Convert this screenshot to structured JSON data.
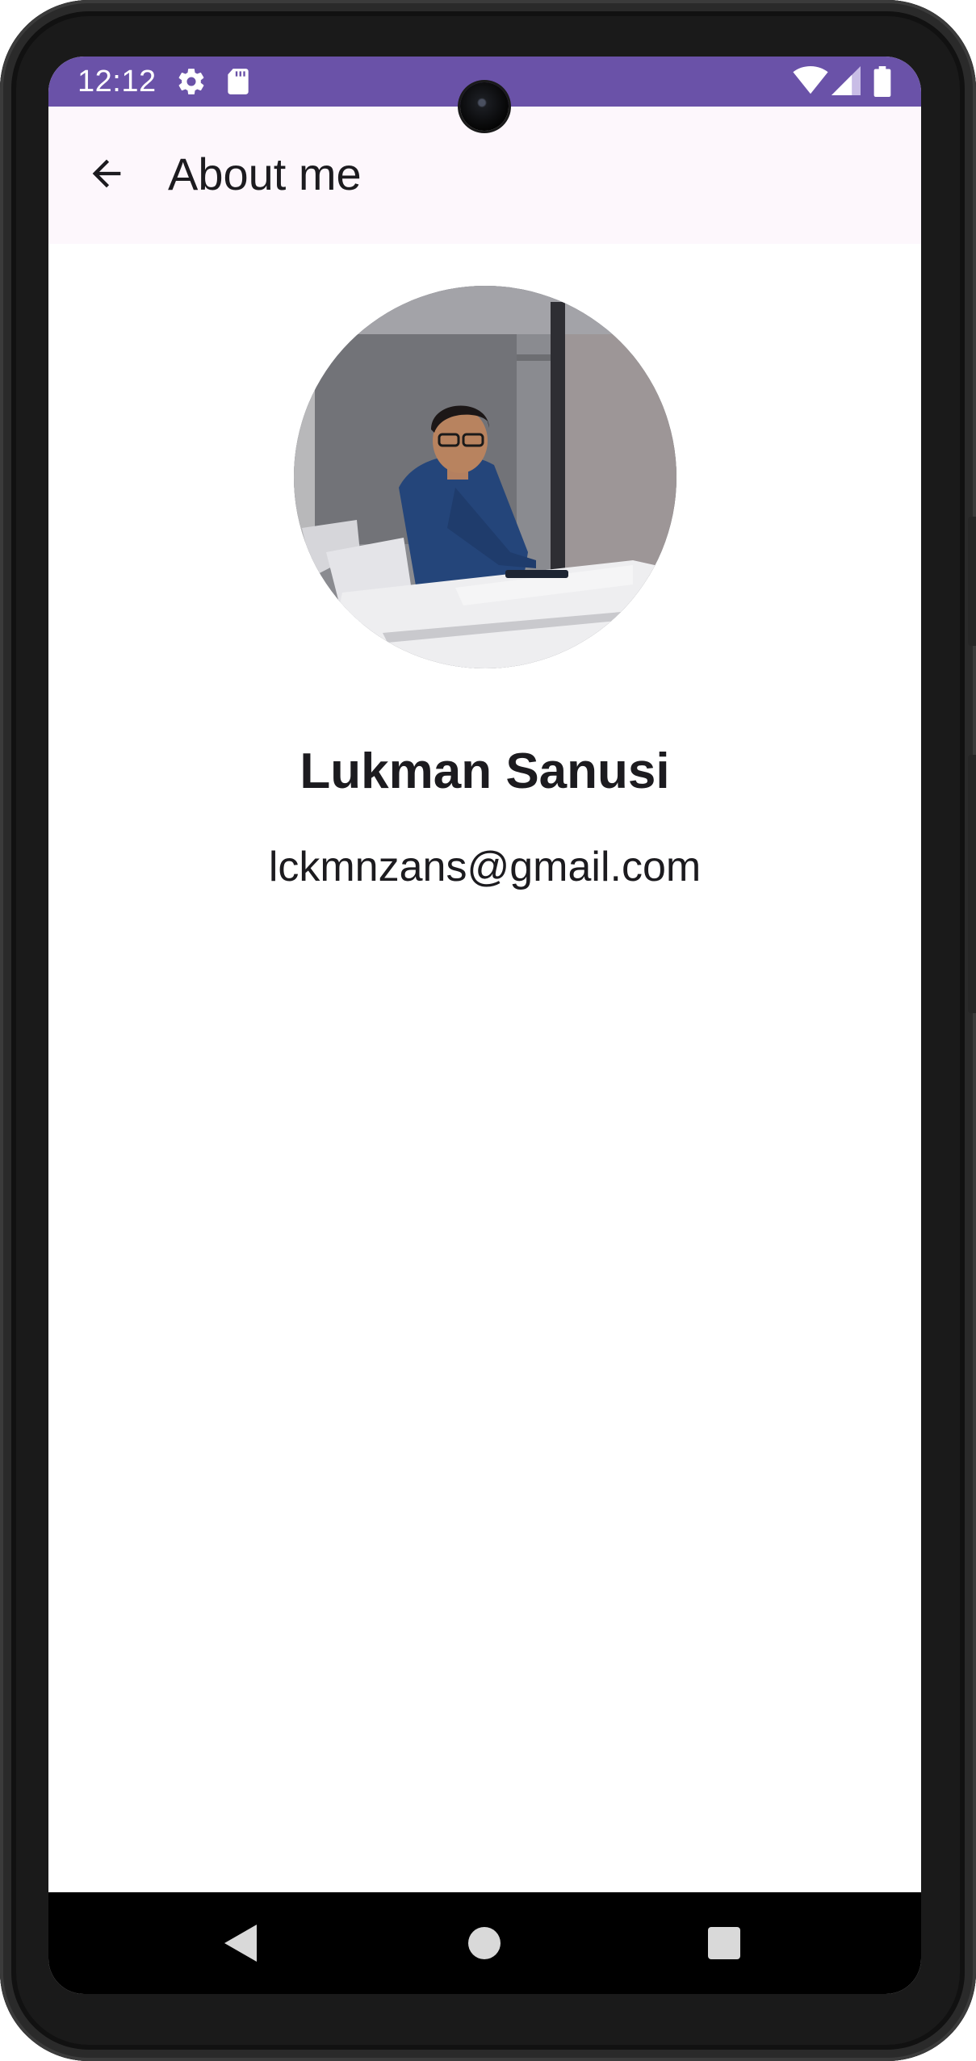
{
  "status_bar": {
    "time": "12:12",
    "left_icons": [
      "gear-icon",
      "sd-card-icon"
    ],
    "right_icons": [
      "wifi-icon",
      "cell-signal-icon",
      "battery-icon"
    ],
    "background_color": "#6a52a8"
  },
  "app_bar": {
    "title": "About me",
    "back_icon": "arrow-back-icon"
  },
  "profile": {
    "name": "Lukman Sanusi",
    "email": "lckmnzans@gmail.com"
  },
  "navigation_bar": {
    "buttons": [
      "back-triangle-icon",
      "home-circle-icon",
      "recents-square-icon"
    ]
  }
}
